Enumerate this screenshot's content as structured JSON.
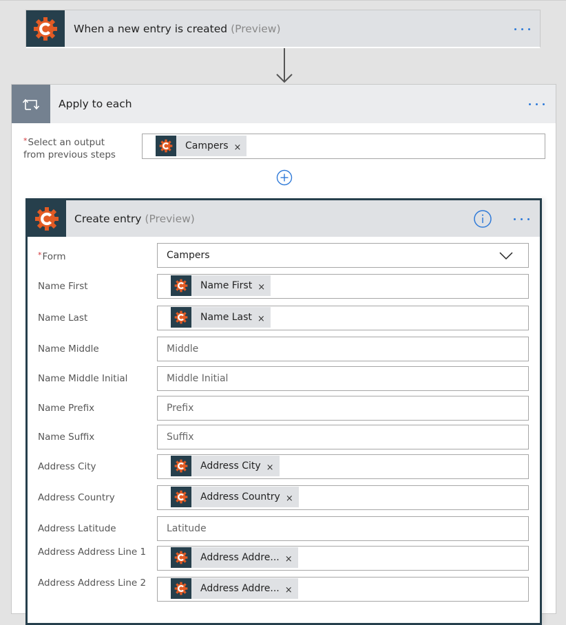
{
  "trigger": {
    "title": "When a new entry is created",
    "preview": "(Preview)",
    "icon": "cognito-forms-logo-icon",
    "more_icon": "more-options-icon"
  },
  "apply_to_each": {
    "title": "Apply to each",
    "icon": "loop-icon",
    "required_marker": "*",
    "label_line1": "Select an output",
    "label_line2": "from previous steps",
    "token": {
      "label": "Campers",
      "remove": "×"
    },
    "add_step_icon": "plus-circle-icon"
  },
  "create_entry": {
    "title": "Create entry",
    "preview": "(Preview)",
    "info_icon": "info-icon",
    "more_icon": "more-options-icon",
    "form": {
      "required_marker": "*",
      "label": "Form",
      "value": "Campers"
    },
    "fields": [
      {
        "label": "Name First",
        "type": "token",
        "token": "Name First",
        "remove": "×"
      },
      {
        "label": "Name Last",
        "type": "token",
        "token": "Name Last",
        "remove": "×"
      },
      {
        "label": "Name Middle",
        "type": "text",
        "placeholder": "Middle"
      },
      {
        "label": "Name Middle Initial",
        "type": "text",
        "placeholder": "Middle Initial"
      },
      {
        "label": "Name Prefix",
        "type": "text",
        "placeholder": "Prefix"
      },
      {
        "label": "Name Suffix",
        "type": "text",
        "placeholder": "Suffix"
      },
      {
        "label": "Address City",
        "type": "token",
        "token": "Address City",
        "remove": "×"
      },
      {
        "label": "Address Country",
        "type": "token",
        "token": "Address Country",
        "remove": "×"
      },
      {
        "label": "Address Latitude",
        "type": "text",
        "placeholder": "Latitude"
      },
      {
        "label": "Address Address Line 1",
        "type": "token",
        "token": "Address Addre...",
        "remove": "×"
      },
      {
        "label": "Address Address Line 2",
        "type": "token",
        "token": "Address Addre...",
        "remove": "×"
      }
    ]
  },
  "colors": {
    "brand_dark": "#263f4c",
    "brand_orange": "#e35b24",
    "accent_blue": "#2f7ad8",
    "required_red": "#d13438"
  }
}
